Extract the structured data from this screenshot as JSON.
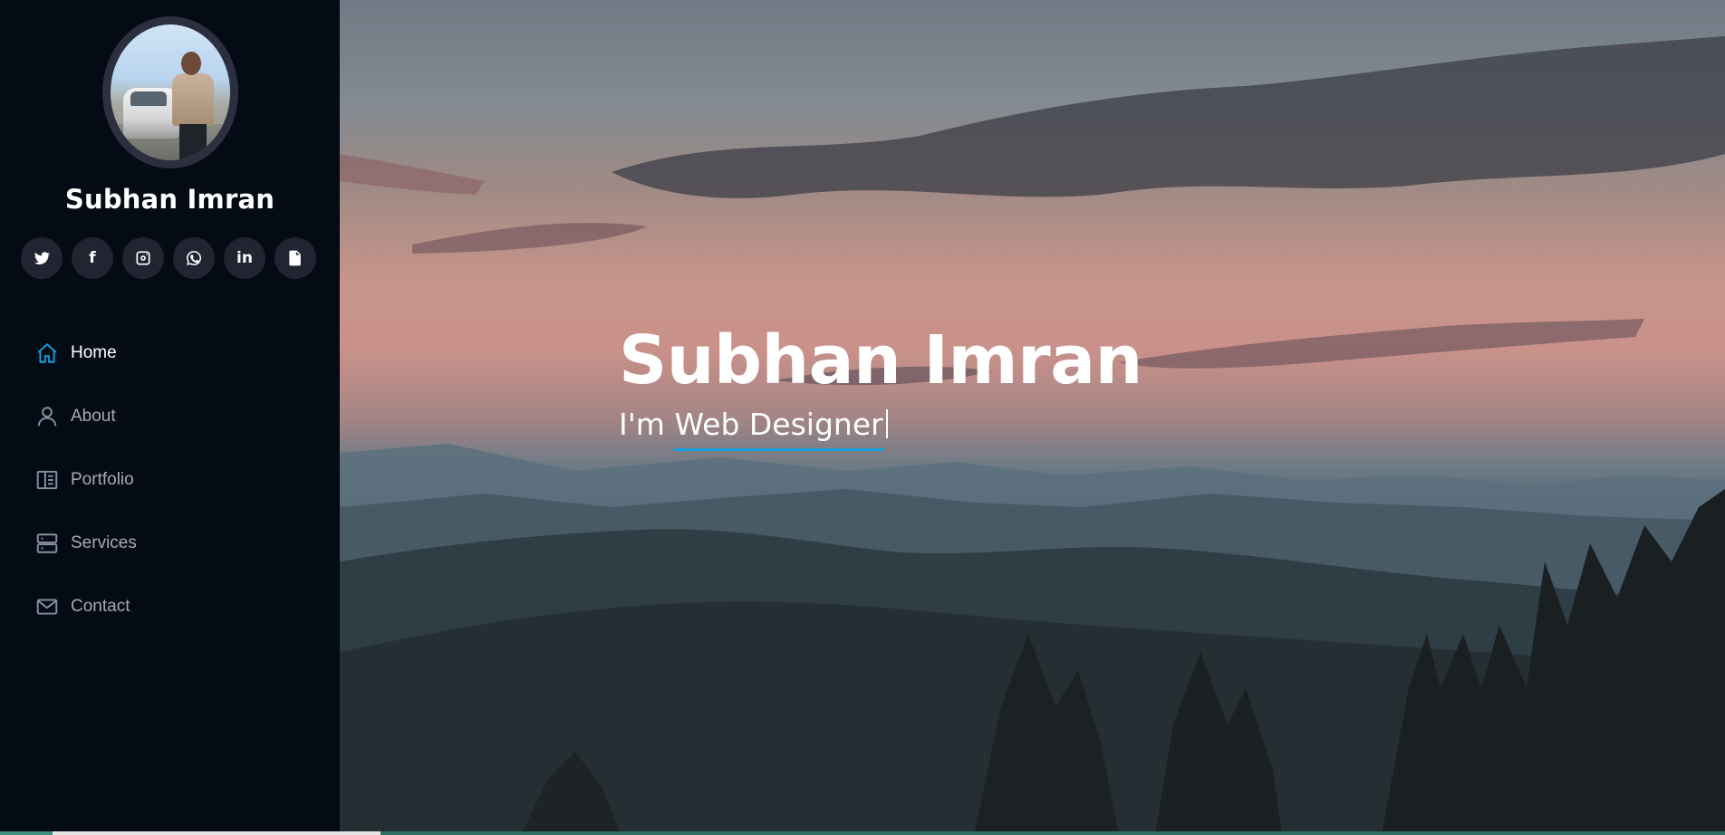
{
  "profile": {
    "name": "Subhan Imran"
  },
  "social": [
    {
      "icon": "twitter-icon",
      "label": ""
    },
    {
      "icon": "facebook-icon",
      "label": "f"
    },
    {
      "icon": "instagram-icon",
      "label": ""
    },
    {
      "icon": "whatsapp-icon",
      "label": ""
    },
    {
      "icon": "linkedin-icon",
      "label": "in"
    },
    {
      "icon": "file-icon",
      "label": ""
    }
  ],
  "nav": {
    "items": [
      {
        "label": "Home",
        "icon": "home-icon",
        "active": true
      },
      {
        "label": "About",
        "icon": "user-icon",
        "active": false
      },
      {
        "label": "Portfolio",
        "icon": "book-icon",
        "active": false
      },
      {
        "label": "Services",
        "icon": "server-icon",
        "active": false
      },
      {
        "label": "Contact",
        "icon": "envelope-icon",
        "active": false
      }
    ]
  },
  "hero": {
    "title": "Subhan Imran",
    "prefix": "I'm ",
    "typed": "Web Designer"
  },
  "colors": {
    "accent": "#149ddd",
    "sidebar_bg": "#040b14",
    "social_bg": "#212431"
  }
}
